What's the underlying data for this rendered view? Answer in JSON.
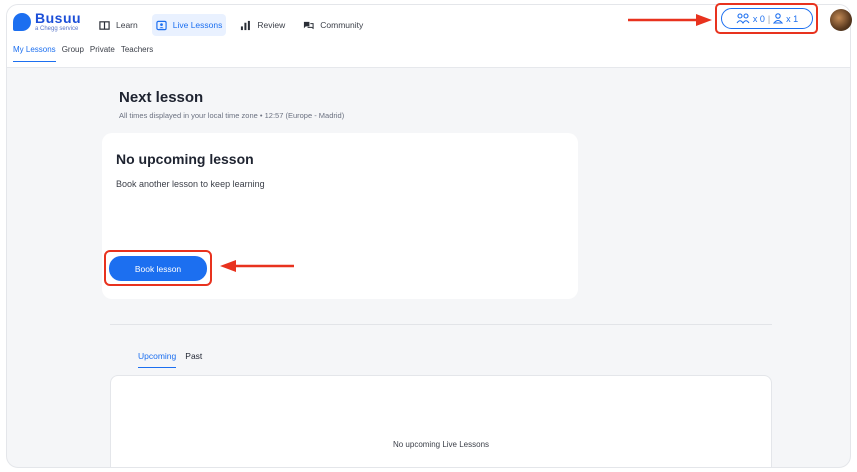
{
  "brand": {
    "name": "Busuu",
    "tagline": "a Chegg service"
  },
  "nav": {
    "items": [
      {
        "label": "Learn",
        "icon": "book-icon"
      },
      {
        "label": "Live Lessons",
        "icon": "video-icon"
      },
      {
        "label": "Review",
        "icon": "bar-chart-icon"
      },
      {
        "label": "Community",
        "icon": "chat-icon"
      }
    ]
  },
  "subnav": {
    "items": [
      "My Lessons",
      "Group",
      "Private",
      "Teachers"
    ]
  },
  "credits": {
    "group_count": "x 0",
    "separator": "|",
    "private_count": "x 1"
  },
  "page": {
    "title": "Next lesson",
    "timezone_note": "All times displayed in your local time zone • 12:57 (Europe - Madrid)"
  },
  "card": {
    "title": "No upcoming lesson",
    "text": "Book another lesson to keep learning",
    "button": "Book lesson"
  },
  "tabs": {
    "items": [
      "Upcoming",
      "Past"
    ]
  },
  "empty_state": "No upcoming Live Lessons",
  "colors": {
    "accent": "#1c6ff0",
    "annotation": "#e8321e"
  }
}
